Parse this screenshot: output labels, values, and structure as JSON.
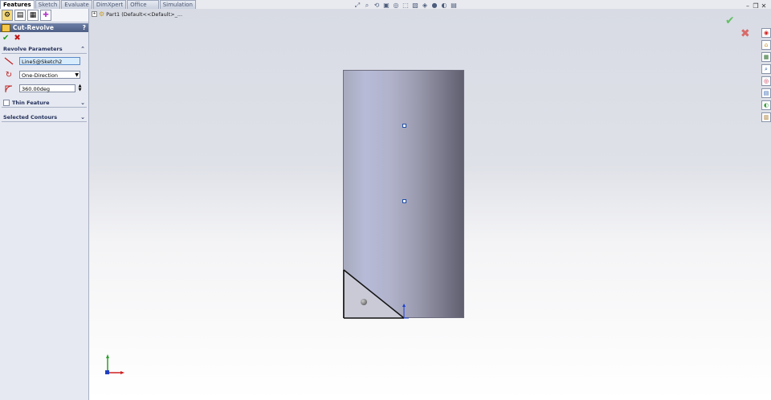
{
  "tabs": [
    {
      "label": "Features",
      "active": true
    },
    {
      "label": "Sketch",
      "active": false
    },
    {
      "label": "Evaluate",
      "active": false
    },
    {
      "label": "DimXpert",
      "active": false
    },
    {
      "label": "Office Products",
      "active": false
    },
    {
      "label": "Simulation",
      "active": false
    }
  ],
  "property_manager": {
    "title": "Cut-Revolve",
    "help": "?",
    "revolve_params": {
      "header": "Revolve Parameters",
      "axis_value": "Line5@Sketch2",
      "direction_value": "One-Direction",
      "angle_value": "360.00deg"
    },
    "thin_feature": {
      "header": "Thin Feature"
    },
    "selected_contours": {
      "header": "Selected Contours"
    }
  },
  "tree": {
    "item_label": "Part1  (Default<<Default>_..."
  },
  "colors": {
    "ok": "#1d9a1d",
    "cancel": "#c01818",
    "title_bar": "#5a6b92",
    "model": "#9fa2bc"
  }
}
